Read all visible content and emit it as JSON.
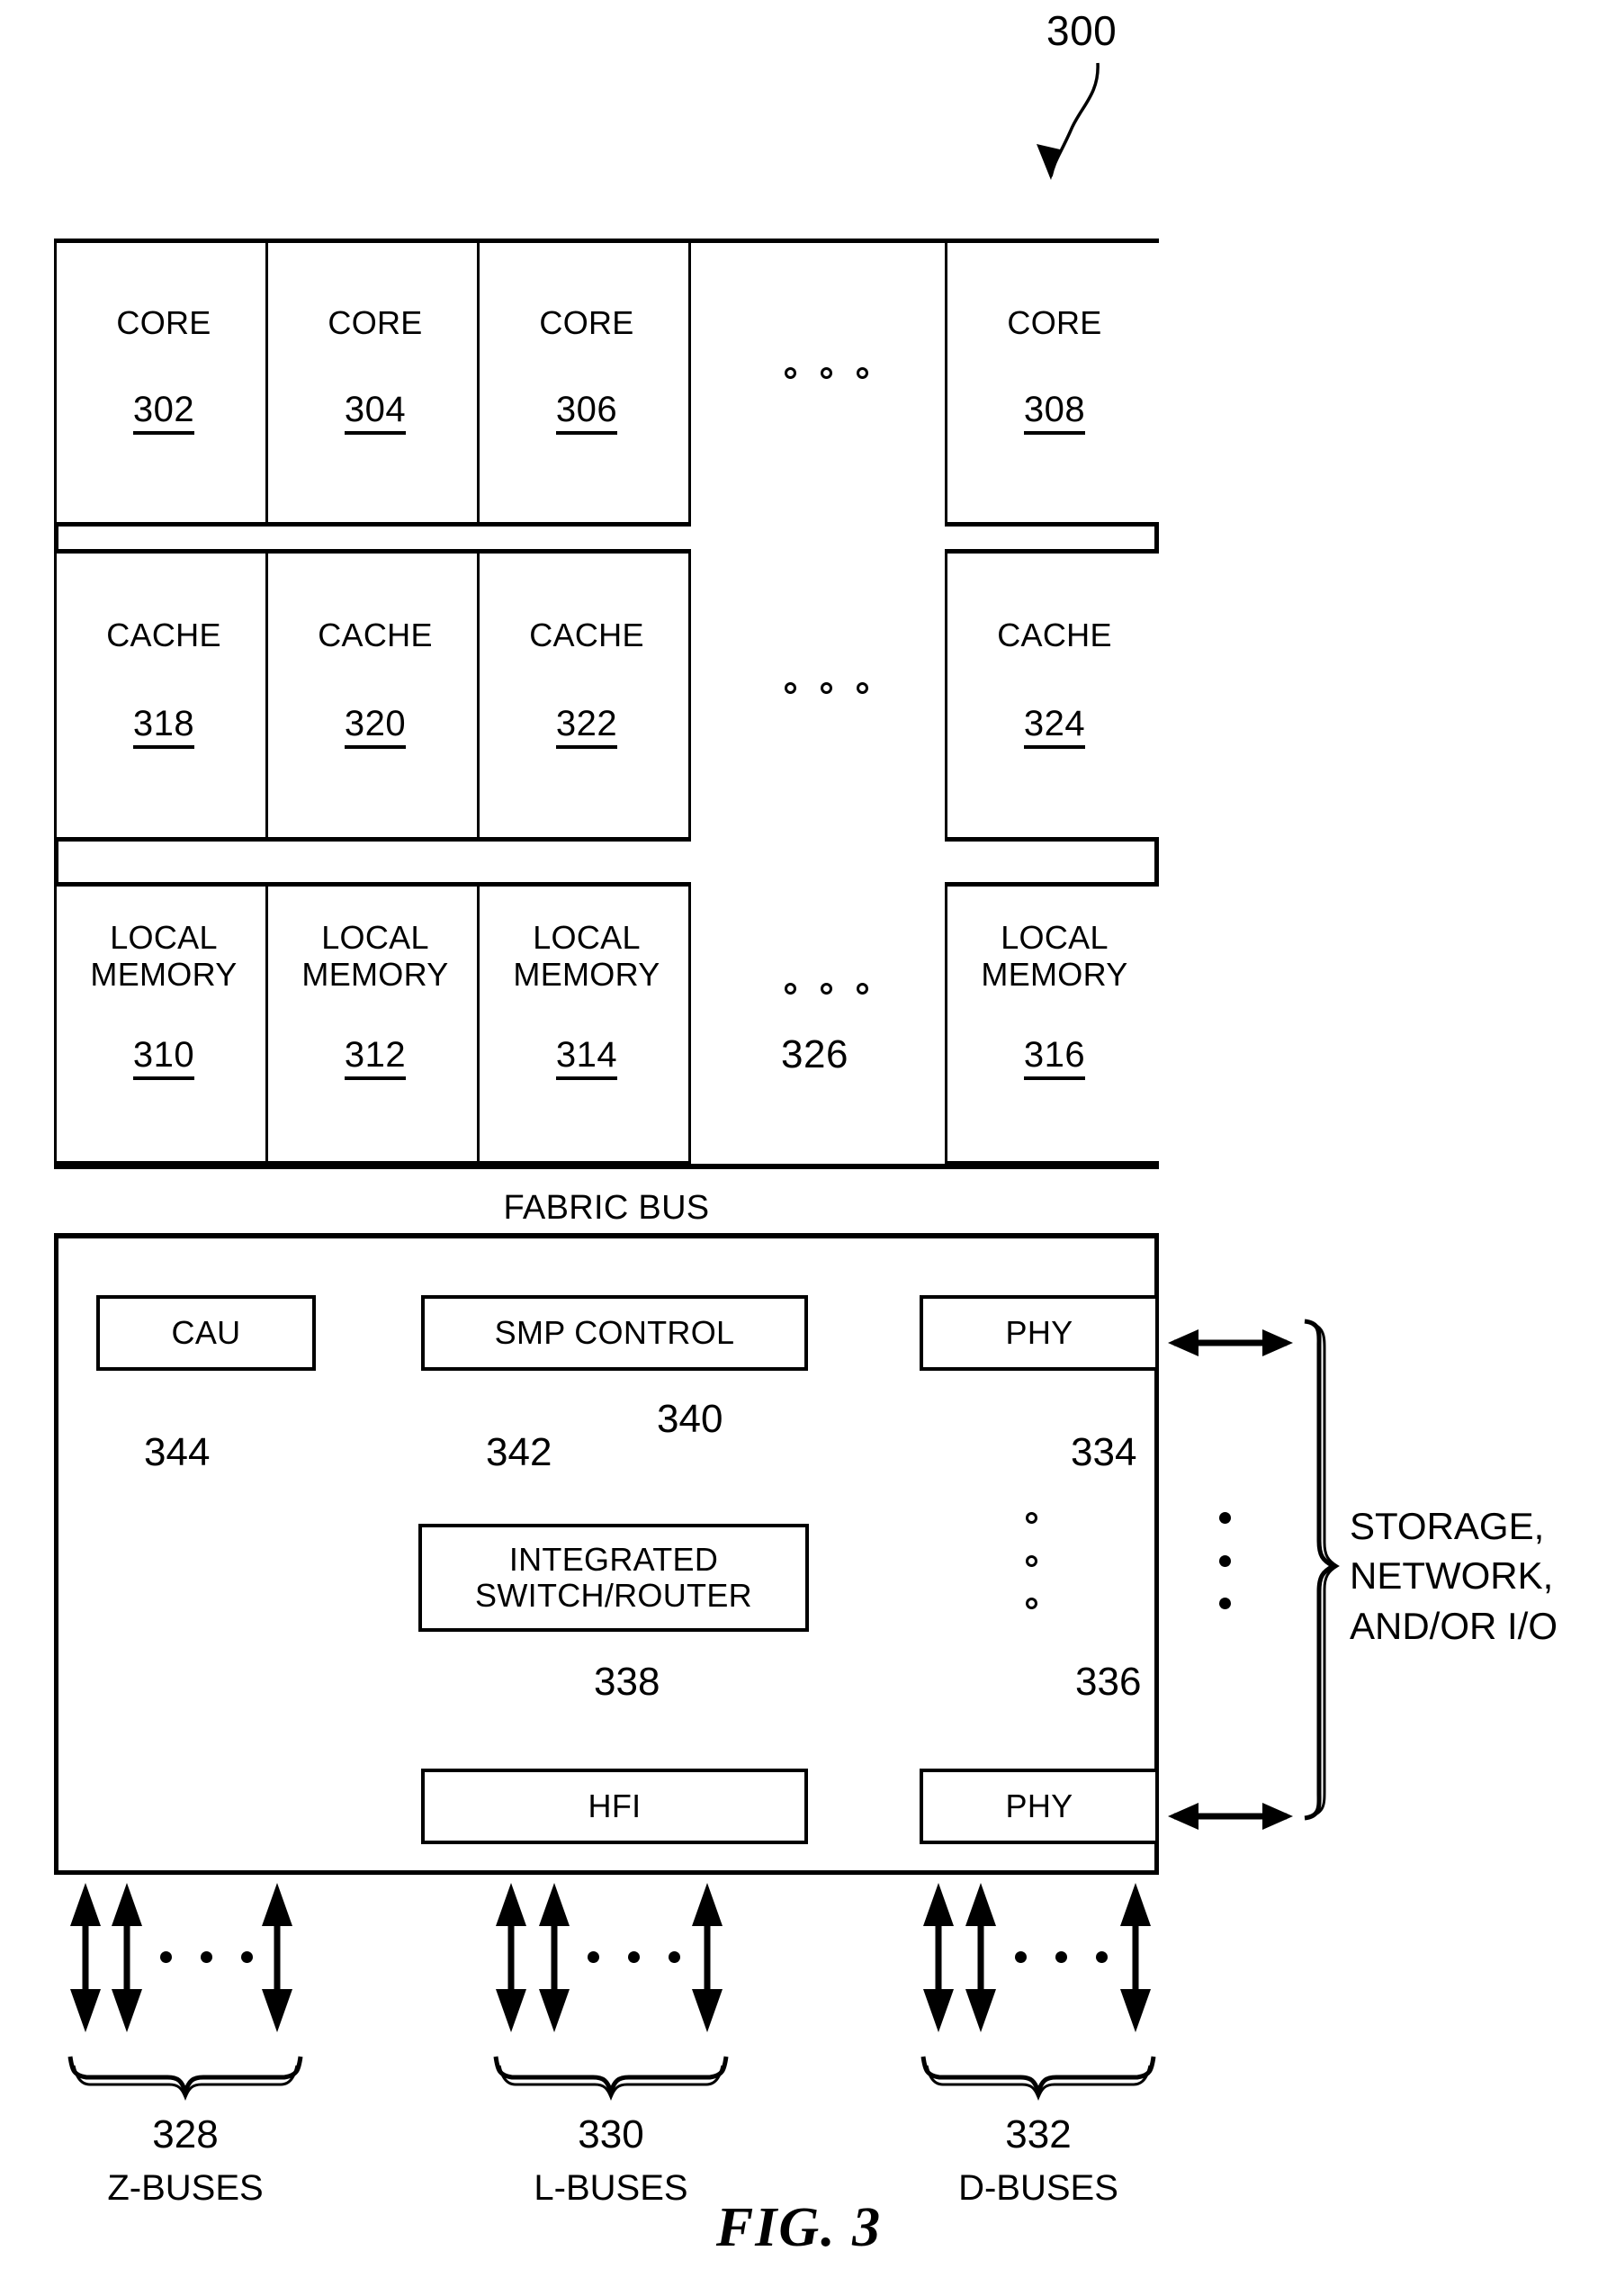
{
  "figure": {
    "caption": "FIG. 3",
    "top_ref": "300"
  },
  "cores": {
    "label": "CORE",
    "items": [
      {
        "label": "CORE",
        "ref": "302"
      },
      {
        "label": "CORE",
        "ref": "304"
      },
      {
        "label": "CORE",
        "ref": "306"
      },
      {
        "label": "CORE",
        "ref": "308"
      }
    ]
  },
  "caches": {
    "label": "CACHE",
    "items": [
      {
        "label": "CACHE",
        "ref": "318"
      },
      {
        "label": "CACHE",
        "ref": "320"
      },
      {
        "label": "CACHE",
        "ref": "322"
      },
      {
        "label": "CACHE",
        "ref": "324"
      }
    ]
  },
  "local_memories": {
    "label_line1": "LOCAL",
    "label_line2": "MEMORY",
    "items": [
      {
        "line1": "LOCAL",
        "line2": "MEMORY",
        "ref": "310"
      },
      {
        "line1": "LOCAL",
        "line2": "MEMORY",
        "ref": "312"
      },
      {
        "line1": "LOCAL",
        "line2": "MEMORY",
        "ref": "314"
      },
      {
        "line1": "LOCAL",
        "line2": "MEMORY",
        "ref": "316"
      }
    ],
    "gap_ref": "326"
  },
  "fabric_bus": {
    "label": "FABRIC BUS"
  },
  "lower_blocks": {
    "cau": {
      "label": "CAU",
      "ref": "344"
    },
    "smp_control": {
      "label": "SMP CONTROL",
      "ref": "342"
    },
    "phy_top": {
      "label": "PHY",
      "ref": "334"
    },
    "integrated_switch_router": {
      "line1": "INTEGRATED",
      "line2": "SWITCH/ROUTER",
      "ref": "340"
    },
    "hfi": {
      "label": "HFI",
      "ref": "338"
    },
    "phy_bottom": {
      "label": "PHY",
      "ref": "336"
    }
  },
  "external": {
    "line1": "STORAGE,",
    "line2": "NETWORK,",
    "line3": "AND/OR I/O"
  },
  "buses": [
    {
      "ref": "328",
      "name": "Z-BUSES"
    },
    {
      "ref": "330",
      "name": "L-BUSES"
    },
    {
      "ref": "332",
      "name": "D-BUSES"
    }
  ],
  "colors": {
    "ink": "#000000",
    "paper": "#ffffff"
  }
}
